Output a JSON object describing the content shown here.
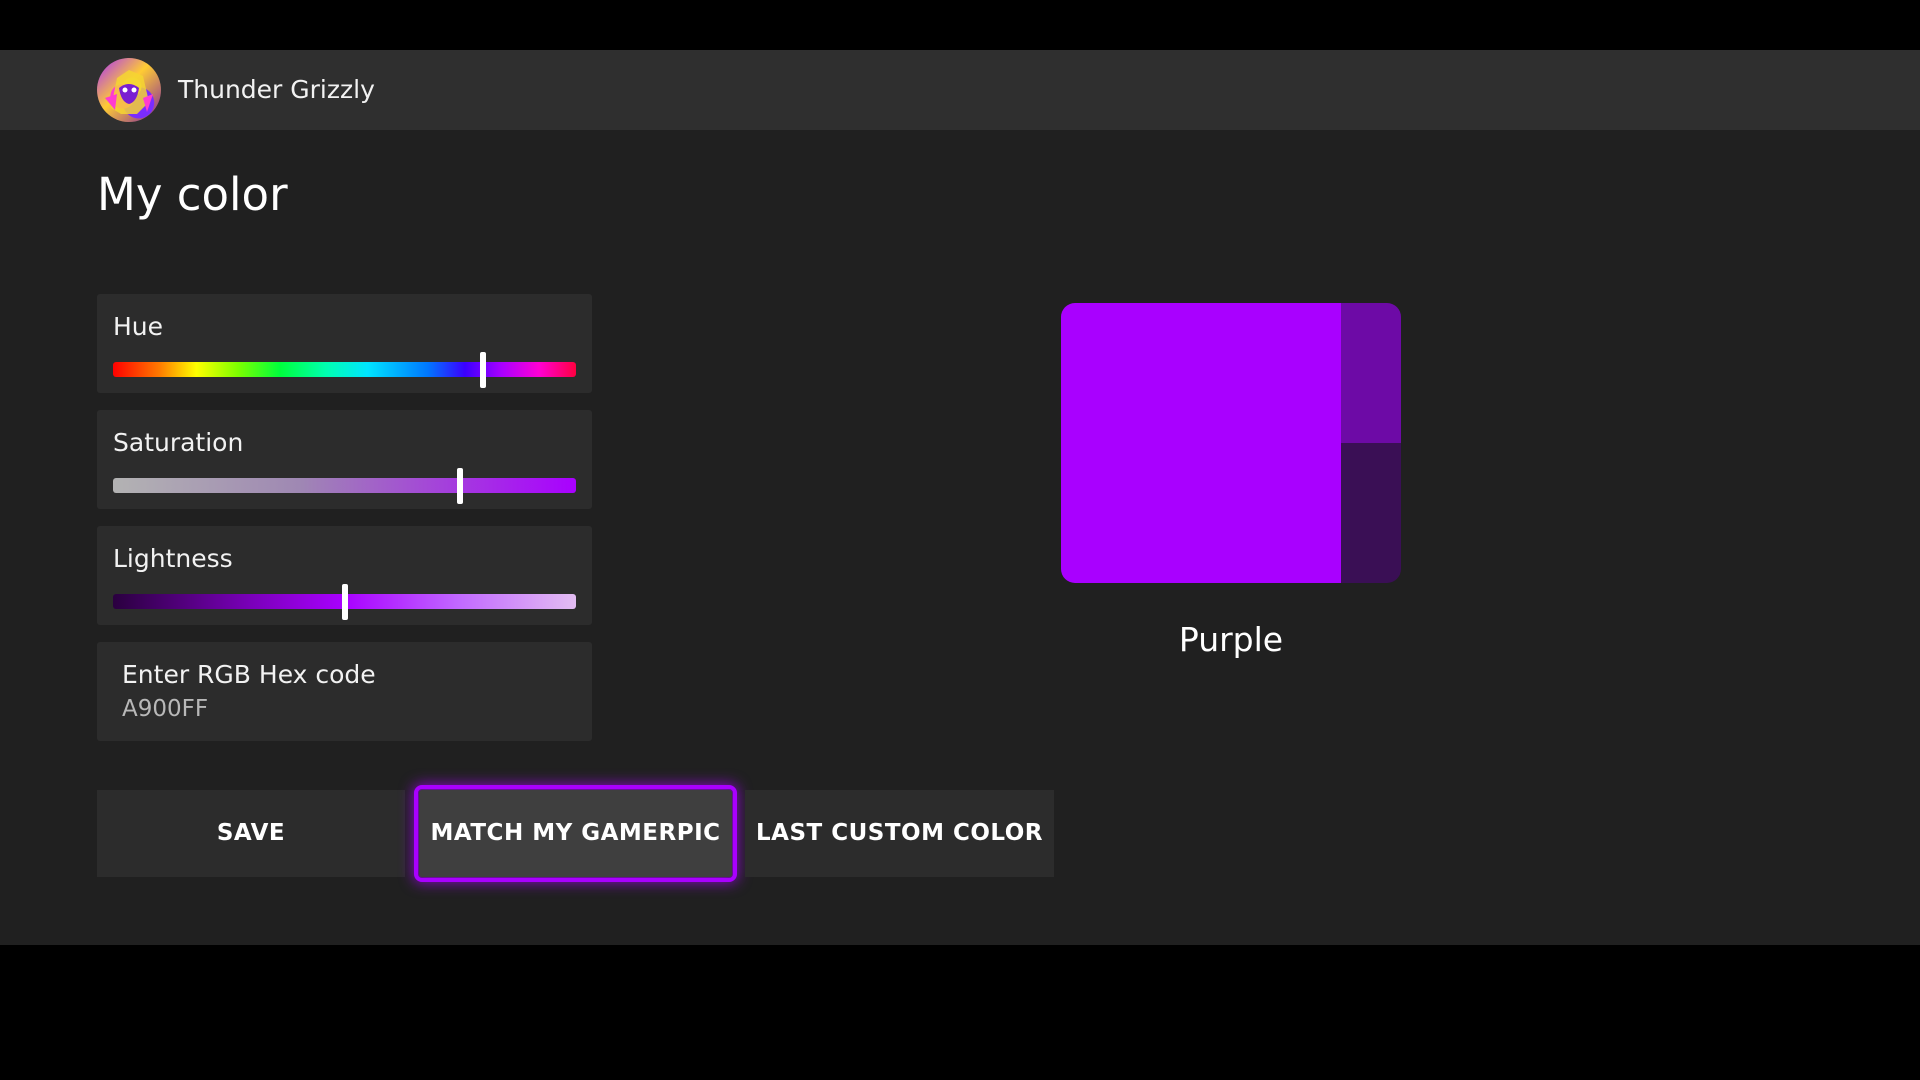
{
  "profile": {
    "gamertag": "Thunder Grizzly"
  },
  "page": {
    "title": "My color"
  },
  "sliders": {
    "hue": {
      "label": "Hue",
      "value": 0.8
    },
    "saturation": {
      "label": "Saturation",
      "value": 0.75
    },
    "lightness": {
      "label": "Lightness",
      "value": 0.5
    }
  },
  "hex": {
    "label": "Enter RGB Hex code",
    "value": "A900FF"
  },
  "buttons": {
    "save": "SAVE",
    "match_gamerpic": "MATCH MY GAMERPIC",
    "last_custom": "LAST CUSTOM COLOR"
  },
  "preview": {
    "name": "Purple",
    "colors": {
      "main": "#a900ff",
      "secondary": "#6d0aa6",
      "dark": "#3a0f55"
    }
  },
  "colors": {
    "accent": "#a900ff",
    "background": "#202020",
    "panel": "#2c2c2c",
    "header": "#2f2f2f"
  },
  "icons": [
    "avatar-gamerpic"
  ]
}
